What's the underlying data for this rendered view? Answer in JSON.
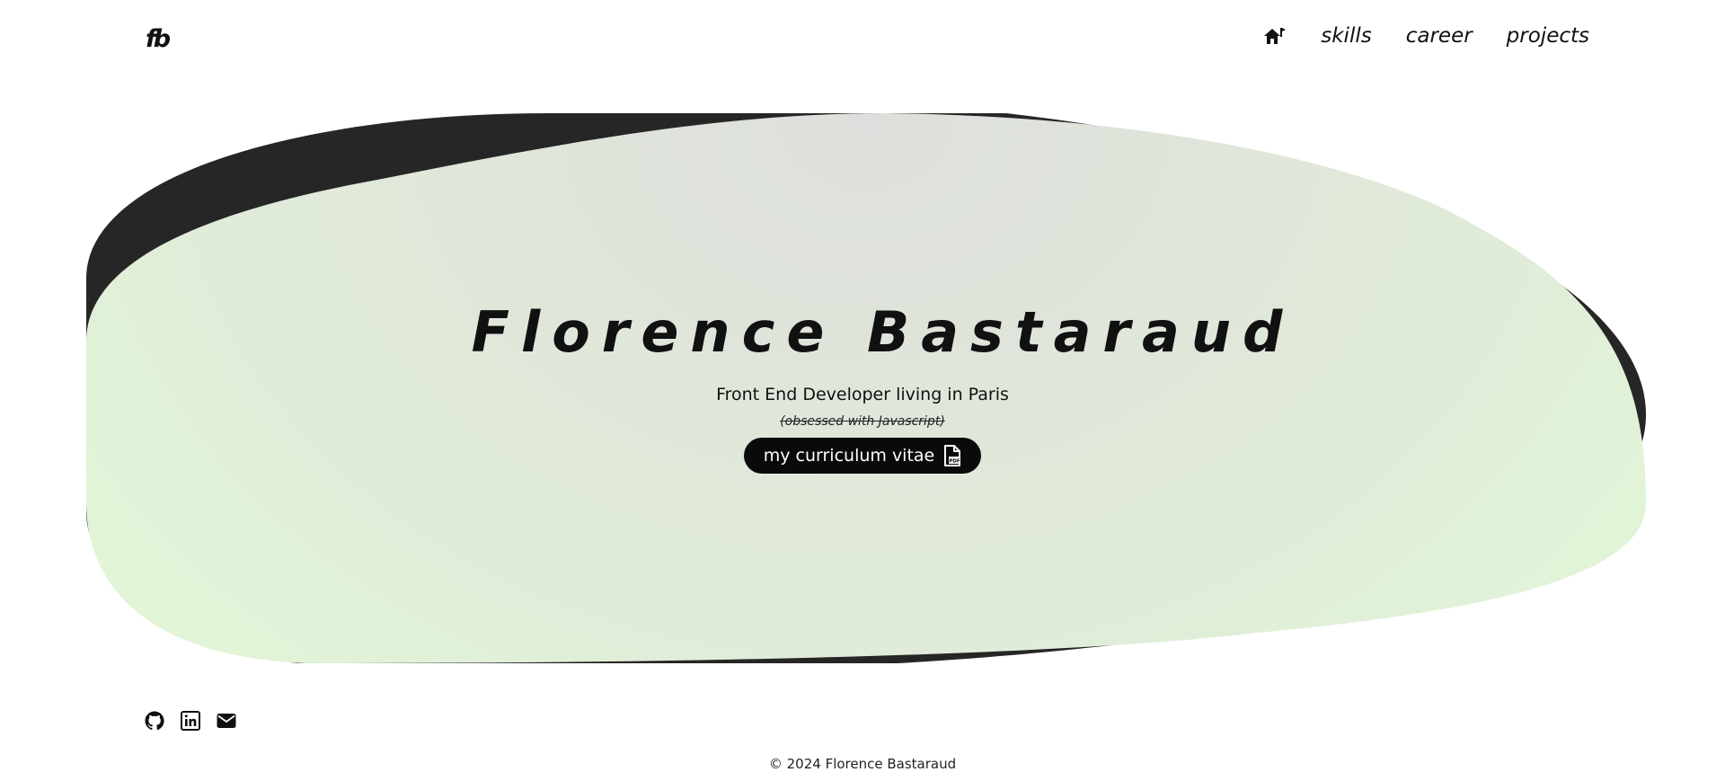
{
  "header": {
    "logo": "fb",
    "nav": {
      "home_icon": "home-icon",
      "links": [
        "skills",
        "career",
        "projects"
      ]
    }
  },
  "hero": {
    "name": "Florence Bastaraud",
    "role": "Front End Developer living in Paris",
    "note": "(obsessed with Javascript)",
    "cv_button": {
      "label": "my curriculum vitae",
      "icon": "pdf-file-icon"
    },
    "colors": {
      "shadow": "#262626",
      "blob_center": "#dfe0dd",
      "blob_edge": "#e3fcd6"
    }
  },
  "footer": {
    "socials": [
      "github-icon",
      "linkedin-icon",
      "mail-icon"
    ],
    "copyright": "© 2024 Florence Bastaraud"
  }
}
